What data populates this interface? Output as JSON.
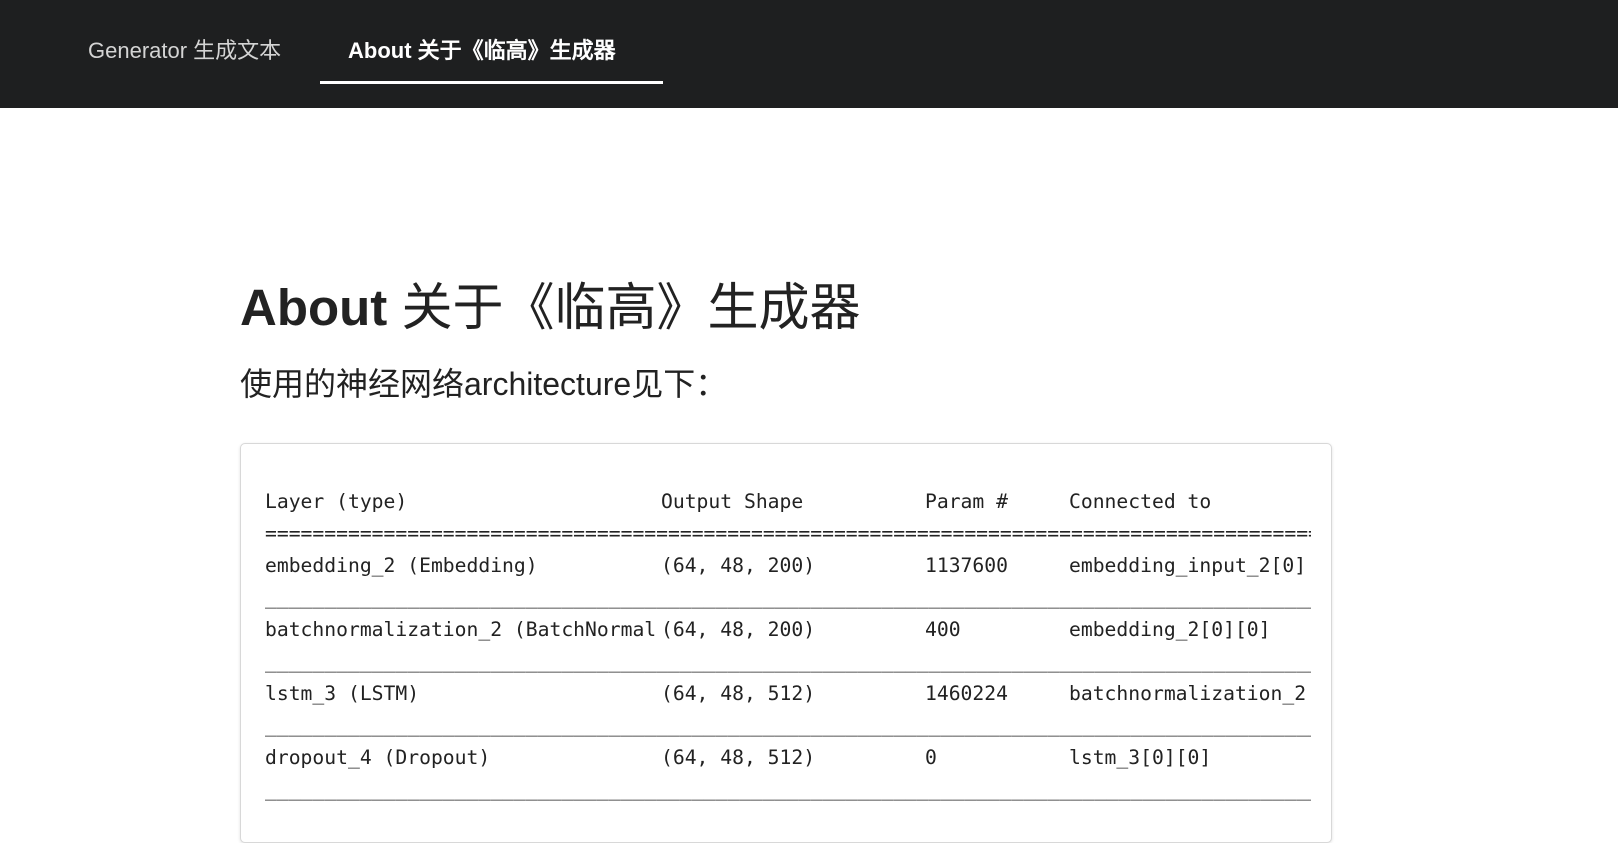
{
  "nav": {
    "tabs": [
      {
        "label": "Generator 生成文本",
        "active": false
      },
      {
        "label": "About 关于《临高》生成器",
        "active": true
      }
    ]
  },
  "page": {
    "title_en": "About",
    "title_zh": " 关于《临高》生成器",
    "lead": "使用的神经网络architecture见下："
  },
  "model_summary": {
    "headers": [
      "Layer (type)",
      "Output Shape",
      "Param #",
      "Connected to"
    ],
    "double_rule": "==========================================================================================",
    "single_rule": "__________________________________________________________________________________________",
    "rows": [
      {
        "layer": "embedding_2 (Embedding)",
        "shape": "(64, 48, 200)",
        "params": "1137600",
        "connected": "embedding_input_2[0]"
      },
      {
        "layer": "batchnormalization_2 (BatchNormal",
        "shape": "(64, 48, 200)",
        "params": "400",
        "connected": "embedding_2[0][0]"
      },
      {
        "layer": "lstm_3 (LSTM)",
        "shape": "(64, 48, 512)",
        "params": "1460224",
        "connected": "batchnormalization_2"
      },
      {
        "layer": "dropout_4 (Dropout)",
        "shape": "(64, 48, 512)",
        "params": "0",
        "connected": "lstm_3[0][0]"
      }
    ]
  },
  "colors": {
    "navbar_bg": "#1e1f20",
    "nav_inactive_text": "#d4d4d4",
    "nav_active_text": "#ffffff",
    "body_text": "#222222",
    "panel_border": "#d8d8d8"
  }
}
